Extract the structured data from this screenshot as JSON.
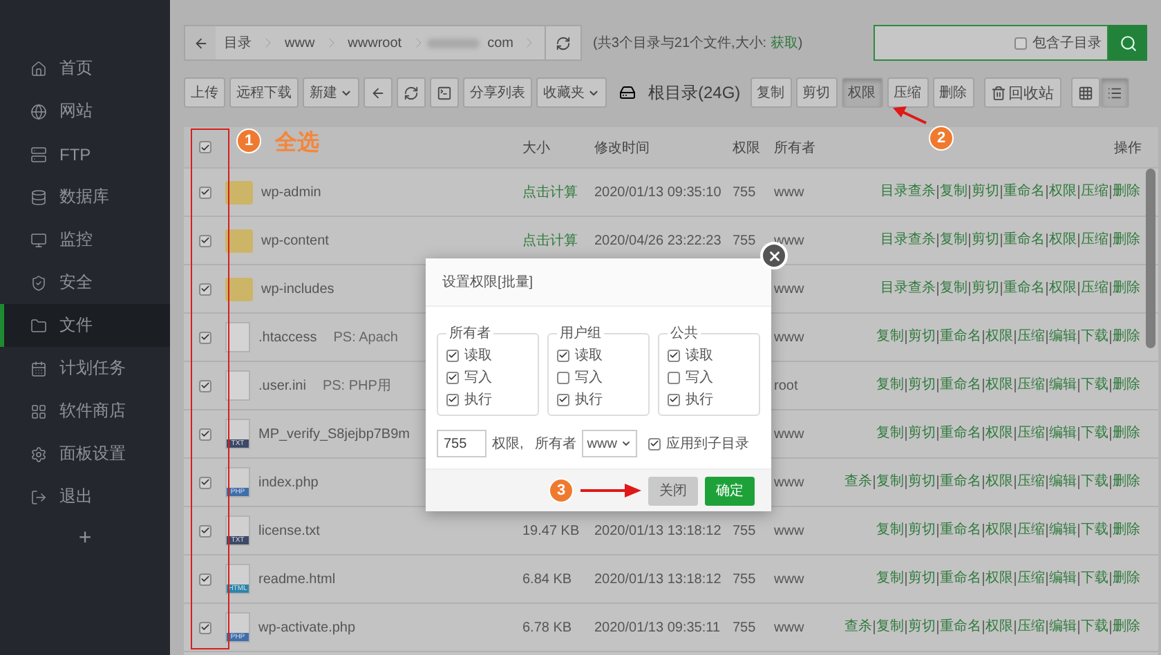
{
  "sidebar": {
    "items": [
      {
        "label": "首页",
        "selected": false
      },
      {
        "label": "网站",
        "selected": false
      },
      {
        "label": "FTP",
        "selected": false
      },
      {
        "label": "数据库",
        "selected": false
      },
      {
        "label": "监控",
        "selected": false
      },
      {
        "label": "安全",
        "selected": false
      },
      {
        "label": "文件",
        "selected": true
      },
      {
        "label": "计划任务",
        "selected": false
      },
      {
        "label": "软件商店",
        "selected": false
      },
      {
        "label": "面板设置",
        "selected": false
      },
      {
        "label": "退出",
        "selected": false
      }
    ],
    "add_button": "+"
  },
  "breadcrumb": {
    "crumbs": [
      "目录",
      "www",
      "wwwroot",
      "com"
    ],
    "summary_prefix": "(共3个目录与21个文件,大小: ",
    "summary_link": "获取",
    "summary_suffix": ")"
  },
  "search": {
    "option": {
      "label": "包含子目录",
      "checked": false
    }
  },
  "toolbar": {
    "left": [
      {
        "kind": "text",
        "label": "上传"
      },
      {
        "kind": "text",
        "label": "远程下载"
      },
      {
        "kind": "menu",
        "label": "新建"
      },
      {
        "kind": "back"
      },
      {
        "kind": "refresh"
      },
      {
        "kind": "terminal"
      },
      {
        "kind": "text",
        "label": "分享列表"
      },
      {
        "kind": "menu",
        "label": "收藏夹"
      }
    ],
    "disk_label": "根目录(24G)",
    "actions": [
      {
        "label": "复制",
        "selected": false
      },
      {
        "label": "剪切",
        "selected": false
      },
      {
        "label": "权限",
        "selected": true
      },
      {
        "label": "压缩",
        "selected": false
      },
      {
        "label": "删除",
        "selected": false
      }
    ],
    "recycle": "回收站",
    "views": [
      {
        "kind": "grid",
        "selected": false
      },
      {
        "kind": "list",
        "selected": true
      }
    ]
  },
  "table": {
    "select_all": true,
    "columns": [
      "大小",
      "修改时间",
      "权限",
      "所有者",
      "操作"
    ],
    "rows": [
      {
        "checked": true,
        "kind": "folder",
        "name": "wp-admin",
        "size": "点击计算",
        "time": "2020/01/13 09:35:10",
        "perm": "755",
        "owner": "www",
        "actions": [
          "目录查杀",
          "复制",
          "剪切",
          "重命名",
          "权限",
          "压缩",
          "删除"
        ]
      },
      {
        "checked": true,
        "kind": "folder",
        "name": "wp-content",
        "size": "点击计算",
        "time": "2020/04/26 23:22:23",
        "perm": "755",
        "owner": "www",
        "actions": [
          "目录查杀",
          "复制",
          "剪切",
          "重命名",
          "权限",
          "压缩",
          "删除"
        ]
      },
      {
        "checked": true,
        "kind": "folder",
        "name": "wp-includes",
        "owner": "www",
        "actions": [
          "目录查杀",
          "复制",
          "剪切",
          "重命名",
          "权限",
          "压缩",
          "删除"
        ]
      },
      {
        "checked": true,
        "kind": "blank",
        "name": ".htaccess",
        "note": "PS: Apach",
        "owner": "www",
        "actions": [
          "复制",
          "剪切",
          "重命名",
          "权限",
          "压缩",
          "编辑",
          "下载",
          "删除"
        ]
      },
      {
        "checked": true,
        "kind": "blank",
        "name": ".user.ini",
        "note": "PS: PHP用",
        "owner": "root",
        "actions": [
          "复制",
          "剪切",
          "重命名",
          "权限",
          "压缩",
          "编辑",
          "下载",
          "删除"
        ]
      },
      {
        "checked": true,
        "kind": "tagged",
        "tag": "TXT",
        "name": "MP_verify_S8jejbp7B9m",
        "owner": "www",
        "actions": [
          "复制",
          "剪切",
          "重命名",
          "权限",
          "压缩",
          "编辑",
          "下载",
          "删除"
        ]
      },
      {
        "checked": true,
        "kind": "tagged",
        "tag": "PHP",
        "name": "index.php",
        "owner": "www",
        "actions": [
          "查杀",
          "复制",
          "剪切",
          "重命名",
          "权限",
          "压缩",
          "编辑",
          "下载",
          "删除"
        ]
      },
      {
        "checked": true,
        "kind": "tagged",
        "tag": "TXT",
        "name": "license.txt",
        "size": "19.47 KB",
        "time": "2020/01/13 13:18:12",
        "perm": "755",
        "owner": "www",
        "actions": [
          "复制",
          "剪切",
          "重命名",
          "权限",
          "压缩",
          "编辑",
          "下载",
          "删除"
        ]
      },
      {
        "checked": true,
        "kind": "tagged",
        "tag": "HTML",
        "name": "readme.html",
        "size": "6.84 KB",
        "time": "2020/01/13 13:18:12",
        "perm": "755",
        "owner": "www",
        "actions": [
          "复制",
          "剪切",
          "重命名",
          "权限",
          "压缩",
          "编辑",
          "下载",
          "删除"
        ]
      },
      {
        "checked": true,
        "kind": "tagged",
        "tag": "PHP",
        "name": "wp-activate.php",
        "size": "6.78 KB",
        "time": "2020/01/13 09:35:11",
        "perm": "755",
        "owner": "www",
        "actions": [
          "查杀",
          "复制",
          "剪切",
          "重命名",
          "权限",
          "压缩",
          "编辑",
          "下载",
          "删除"
        ]
      }
    ]
  },
  "dialog": {
    "title": "设置权限[批量]",
    "groups": [
      {
        "title": "所有者",
        "options": [
          {
            "label": "读取",
            "checked": true
          },
          {
            "label": "写入",
            "checked": true
          },
          {
            "label": "执行",
            "checked": true
          }
        ]
      },
      {
        "title": "用户组",
        "options": [
          {
            "label": "读取",
            "checked": true
          },
          {
            "label": "写入",
            "checked": false
          },
          {
            "label": "执行",
            "checked": true
          }
        ]
      },
      {
        "title": "公共",
        "options": [
          {
            "label": "读取",
            "checked": true
          },
          {
            "label": "写入",
            "checked": false
          },
          {
            "label": "执行",
            "checked": true
          }
        ]
      }
    ],
    "perm_value": "755",
    "perm_label": "权限,",
    "owner_label": "所有者",
    "owner_value": "www",
    "apply_sub": {
      "label": "应用到子目录",
      "checked": true
    },
    "cancel": "关闭",
    "confirm": "确定"
  },
  "annotations": [
    {
      "number": "1",
      "label": "全选"
    },
    {
      "number": "2"
    },
    {
      "number": "3"
    }
  ]
}
